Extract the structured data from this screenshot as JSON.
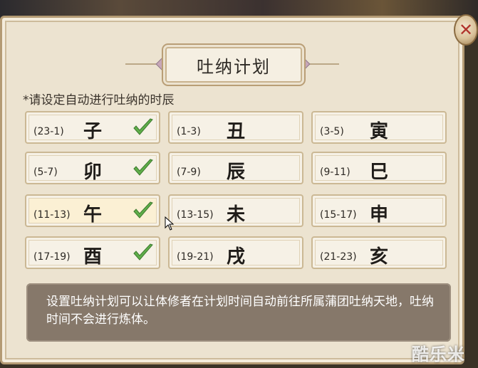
{
  "dialog": {
    "title": "吐纳计划",
    "instruction": "*请设定自动进行吐纳的时辰",
    "close_icon": "close-icon",
    "info_text": "设置吐纳计划可以让体修者在计划时间自动前往所属蒲团吐纳天地，吐纳时间不会进行炼体。",
    "check_color": "#5fae4a",
    "accent_color": "#b0332b"
  },
  "slots": [
    {
      "branch": "子",
      "range": "(23-1)",
      "checked": true
    },
    {
      "branch": "丑",
      "range": "(1-3)",
      "checked": false
    },
    {
      "branch": "寅",
      "range": "(3-5)",
      "checked": false
    },
    {
      "branch": "卯",
      "range": "(5-7)",
      "checked": true
    },
    {
      "branch": "辰",
      "range": "(7-9)",
      "checked": false
    },
    {
      "branch": "巳",
      "range": "(9-11)",
      "checked": false
    },
    {
      "branch": "午",
      "range": "(11-13)",
      "checked": true
    },
    {
      "branch": "未",
      "range": "(13-15)",
      "checked": false
    },
    {
      "branch": "申",
      "range": "(15-17)",
      "checked": false
    },
    {
      "branch": "酉",
      "range": "(17-19)",
      "checked": true
    },
    {
      "branch": "戌",
      "range": "(19-21)",
      "checked": false
    },
    {
      "branch": "亥",
      "range": "(21-23)",
      "checked": false
    }
  ],
  "watermark": "酷乐米"
}
